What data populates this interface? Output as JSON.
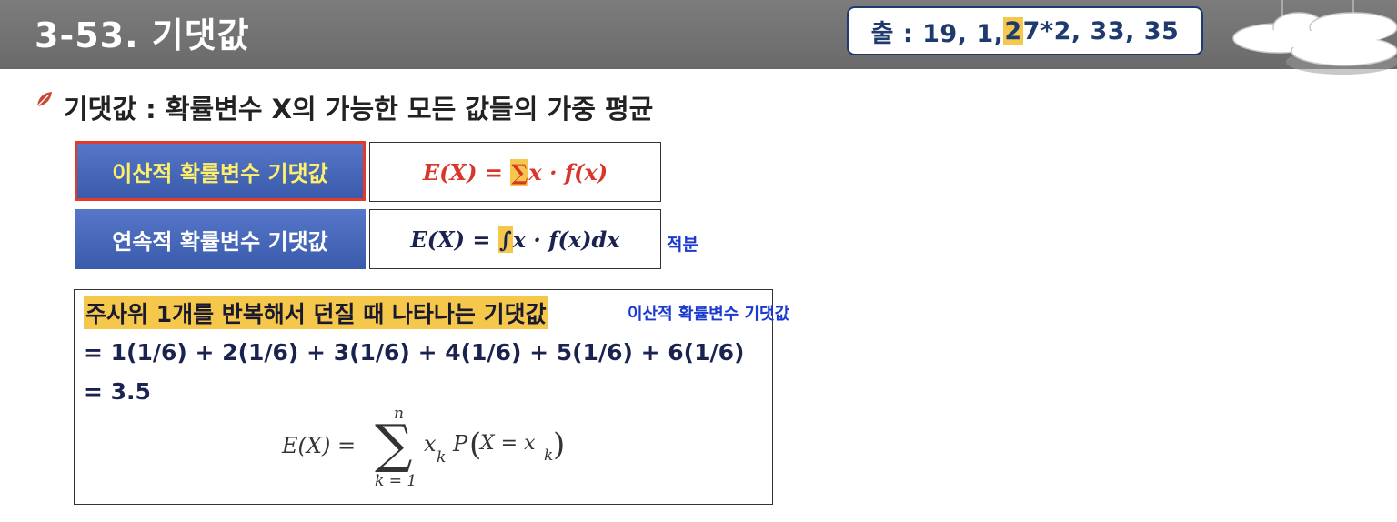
{
  "header": {
    "title": "3-53. 기댓값",
    "source": {
      "prefix": "출 : 19, 1, ",
      "highlight": "2",
      "suffix": "7*2, 33, 35"
    }
  },
  "headline": "기댓값 : 확률변수 X의 가능한 모든 값들의 가중 평균",
  "rows": [
    {
      "label": "이산적 확률변수 기댓값",
      "formula": {
        "lhs": "E(X) = ",
        "symbol": "∑",
        "rhs": "x · f(x)"
      }
    },
    {
      "label": "연속적 확률변수 기댓값",
      "formula": {
        "lhs": "E(X) = ",
        "symbol": "∫",
        "rhs": " x · f(x)dx"
      },
      "note": "적분"
    }
  ],
  "example": {
    "title": "주사위 1개를 반복해서 던질 때 나타나는 기댓값",
    "tag": "이산적 확률변수 기댓값",
    "line1": "= 1(1/6) + 2(1/6) + 3(1/6) + 4(1/6) + 5(1/6) + 6(1/6)",
    "line2": "= 3.5",
    "formula": {
      "lhs": "E(X) =",
      "sigma": "∑",
      "upper": "n",
      "lower": "k = 1",
      "term_x": "x",
      "sub_k": "k",
      "rest": "P",
      "inner": "X = x"
    }
  },
  "colors": {
    "header_bg": "#6e6e6e",
    "label_blue": "#4466bb",
    "highlight": "#f5c84c",
    "accent_red": "#d8362a",
    "note_blue": "#1a3ad0"
  },
  "icons": [
    "leaf-bullet-icon",
    "cloud-decoration"
  ]
}
